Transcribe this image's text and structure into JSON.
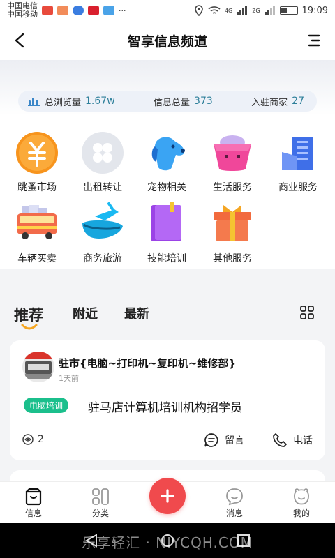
{
  "status_bar": {
    "carrier1": "中国电信",
    "carrier2": "中国移动",
    "signal1": "4G",
    "signal2": "2G",
    "time": "19:09",
    "dots": "···"
  },
  "header": {
    "title": "智享信息频道"
  },
  "stats": {
    "views_label": "总浏览量",
    "views_value": "1.67w",
    "total_label": "信息总量",
    "total_value": "373",
    "merchants_label": "入驻商家",
    "merchants_value": "27"
  },
  "categories": [
    {
      "label": "跳蚤市场",
      "icon": "yuan-coin-icon"
    },
    {
      "label": "出租转让",
      "icon": "clover-icon"
    },
    {
      "label": "宠物相关",
      "icon": "dog-icon"
    },
    {
      "label": "生活服务",
      "icon": "basket-icon"
    },
    {
      "label": "商业服务",
      "icon": "building-icon"
    },
    {
      "label": "车辆买卖",
      "icon": "bus-icon"
    },
    {
      "label": "商务旅游",
      "icon": "airplane-icon"
    },
    {
      "label": "技能培训",
      "icon": "book-icon"
    },
    {
      "label": "其他服务",
      "icon": "gift-icon"
    }
  ],
  "tabs": {
    "items": [
      "推荐",
      "附近",
      "最新"
    ],
    "active": 0
  },
  "card": {
    "title": "驻市{电脑~打印机~复印机~维修部}",
    "time": "1天前",
    "tag": "电脑培训",
    "description": "驻马店计算机培训机构招学员",
    "views": "2",
    "comment_label": "留言",
    "phone_label": "电话"
  },
  "bottom_nav": {
    "items": [
      {
        "label": "信息",
        "icon": "info-basket-icon"
      },
      {
        "label": "分类",
        "icon": "category-icon"
      },
      {
        "label": "消息",
        "icon": "message-icon"
      },
      {
        "label": "我的",
        "icon": "profile-icon"
      }
    ],
    "fab_icon": "plus-icon"
  },
  "watermark": "乐享轻汇 · NIYCQH.COM",
  "colors": {
    "accent_red": "#f04a4d",
    "tag_green": "#1bbf8c",
    "stat_number": "#2d7f9a"
  }
}
